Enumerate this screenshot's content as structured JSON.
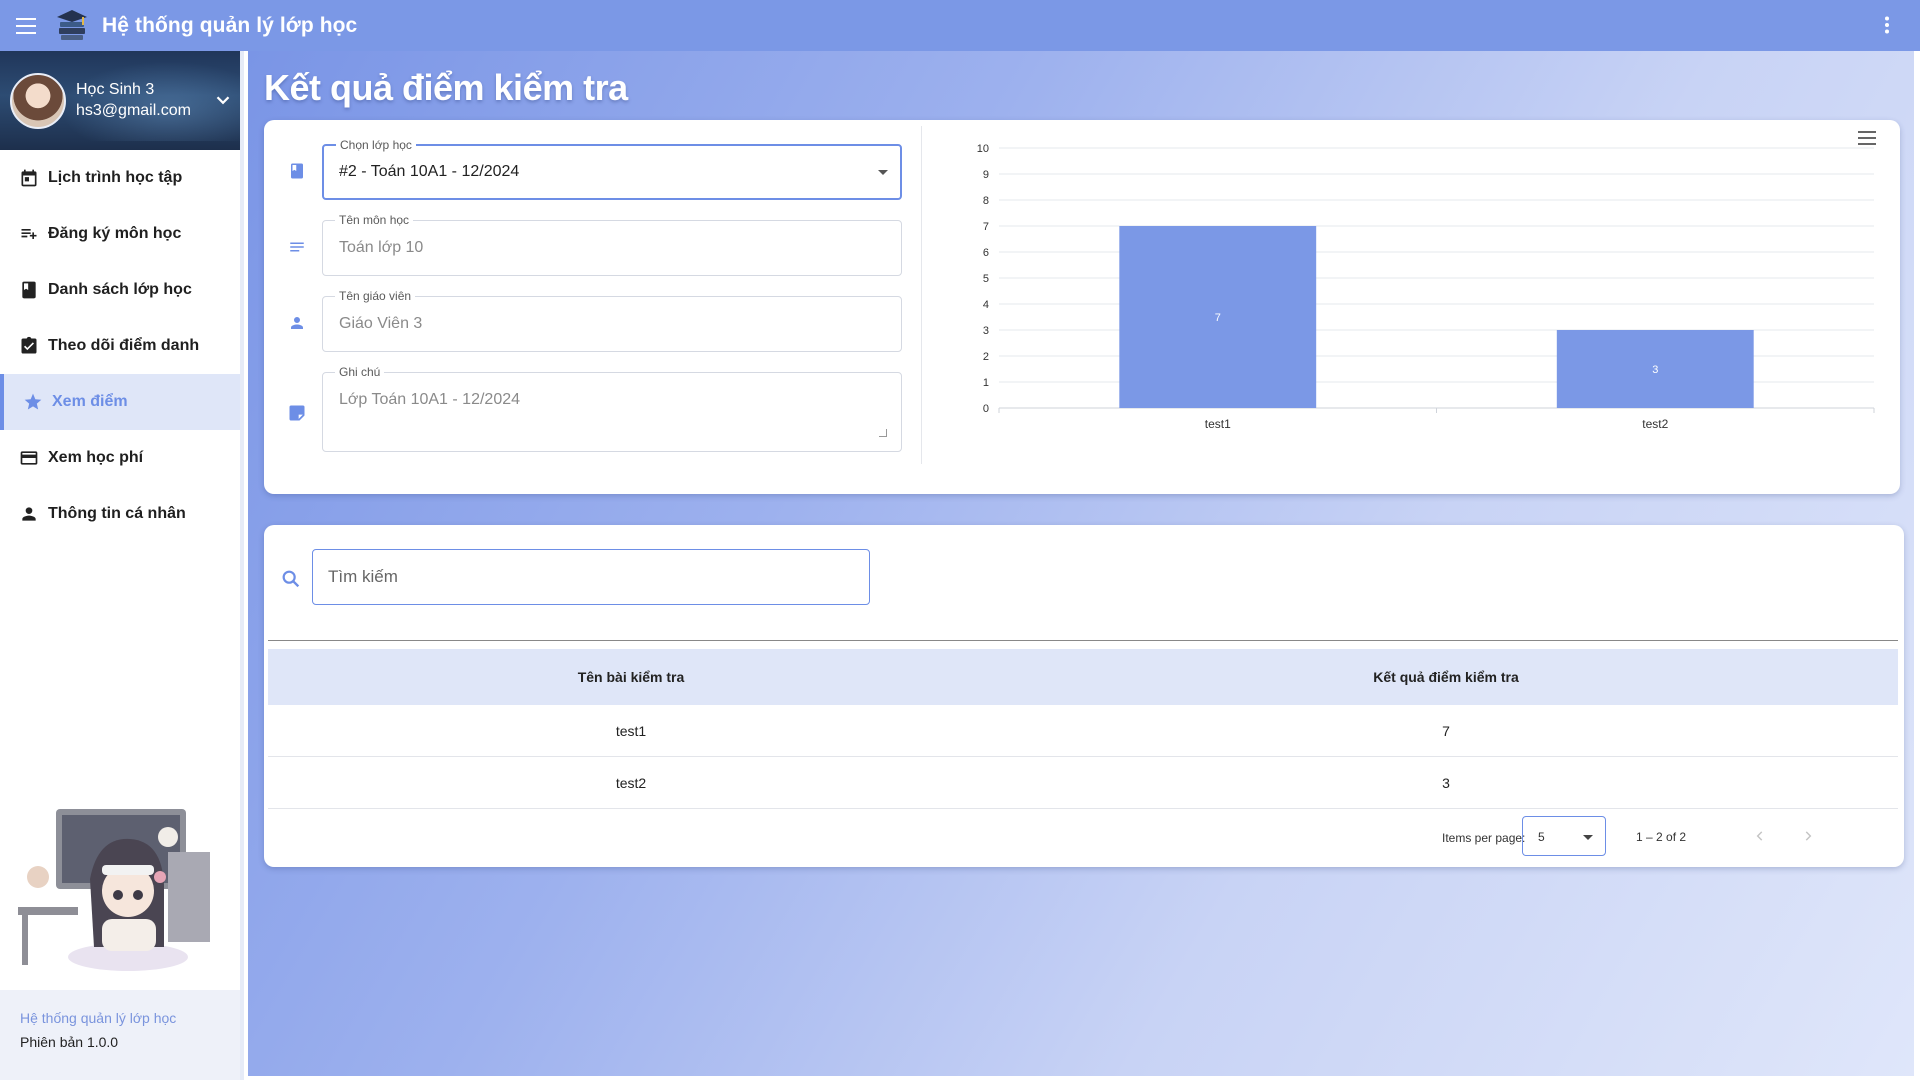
{
  "app": {
    "title": "Hệ thống quản lý lớp học"
  },
  "profile": {
    "name": "Học Sinh 3",
    "email": "hs3@gmail.com"
  },
  "sidebar": {
    "items": [
      {
        "label": "Lịch trình học tập",
        "icon": "calendar-icon"
      },
      {
        "label": "Đăng ký môn học",
        "icon": "playlist-add-icon"
      },
      {
        "label": "Danh sách lớp học",
        "icon": "book-icon"
      },
      {
        "label": "Theo dõi điểm danh",
        "icon": "assignment-check-icon"
      },
      {
        "label": "Xem điểm",
        "icon": "star-icon",
        "active": true
      },
      {
        "label": "Xem học phí",
        "icon": "credit-card-icon"
      },
      {
        "label": "Thông tin cá nhân",
        "icon": "person-icon"
      }
    ],
    "footer": {
      "app_name": "Hệ thống quản lý lớp học",
      "version_label": "Phiên bản",
      "version": "1.0.0"
    }
  },
  "page": {
    "title": "Kết quả điểm kiểm tra"
  },
  "form": {
    "class_select": {
      "label": "Chọn lớp học",
      "value": "#2 - Toán 10A1 - 12/2024"
    },
    "subject": {
      "label": "Tên môn học",
      "value": "Toán lớp 10"
    },
    "teacher": {
      "label": "Tên giáo viên",
      "value": "Giáo Viên 3"
    },
    "note": {
      "label": "Ghi chú",
      "value": "Lớp Toán 10A1 - 12/2024"
    }
  },
  "chart_data": {
    "type": "bar",
    "categories": [
      "test1",
      "test2"
    ],
    "values": [
      7,
      3
    ],
    "data_labels": [
      "7",
      "3"
    ],
    "title": "",
    "xlabel": "",
    "ylabel": "",
    "ylim": [
      0,
      10
    ],
    "yticks": [
      0,
      1,
      2,
      3,
      4,
      5,
      6,
      7,
      8,
      9,
      10
    ],
    "grid": true,
    "bar_color": "#7b98e6"
  },
  "search": {
    "placeholder": "Tìm kiếm"
  },
  "table": {
    "headers": [
      "Tên bài kiểm tra",
      "Kết quả điểm kiểm tra"
    ],
    "rows": [
      [
        "test1",
        "7"
      ],
      [
        "test2",
        "3"
      ]
    ]
  },
  "paginator": {
    "items_per_page_label": "Items per page:",
    "page_size": "5",
    "range": "1 – 2 of 2"
  },
  "colors": {
    "primary": "#7b98e6",
    "accent": "#6d8ee6",
    "active_bg": "#dfe6f8"
  }
}
